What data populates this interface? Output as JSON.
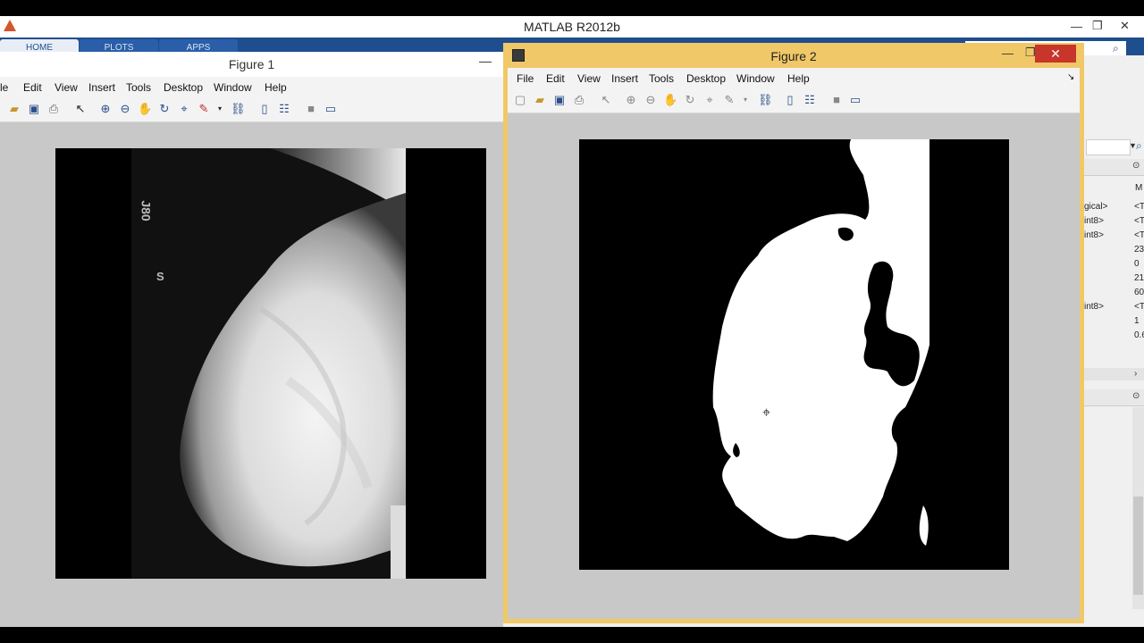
{
  "matlab": {
    "title": "MATLAB R2012b",
    "tabs": [
      "HOME",
      "PLOTS",
      "APPS"
    ],
    "window_buttons": {
      "minimize": "—",
      "restore": "❐",
      "close": "✕"
    }
  },
  "figure1": {
    "title": "Figure 1",
    "menu": [
      "le",
      "Edit",
      "View",
      "Insert",
      "Tools",
      "Desktop",
      "Window",
      "Help"
    ],
    "film_marks": [
      "J80",
      "S"
    ]
  },
  "figure2": {
    "title": "Figure 2",
    "menu": [
      "File",
      "Edit",
      "View",
      "Insert",
      "Tools",
      "Desktop",
      "Window",
      "Help"
    ]
  },
  "workspace": {
    "header": "M",
    "names": [
      "gical>",
      "int8>",
      "int8>",
      "",
      "",
      "",
      "",
      "int8>",
      "",
      ""
    ],
    "values": [
      "<T",
      "<T",
      "<T",
      "23",
      "0",
      "21",
      "60",
      "<T",
      "1",
      "0.6"
    ]
  },
  "colors": {
    "figure2_frame": "#f0c868",
    "ribbon": "#1f4e8f",
    "close_button": "#c8352a"
  }
}
